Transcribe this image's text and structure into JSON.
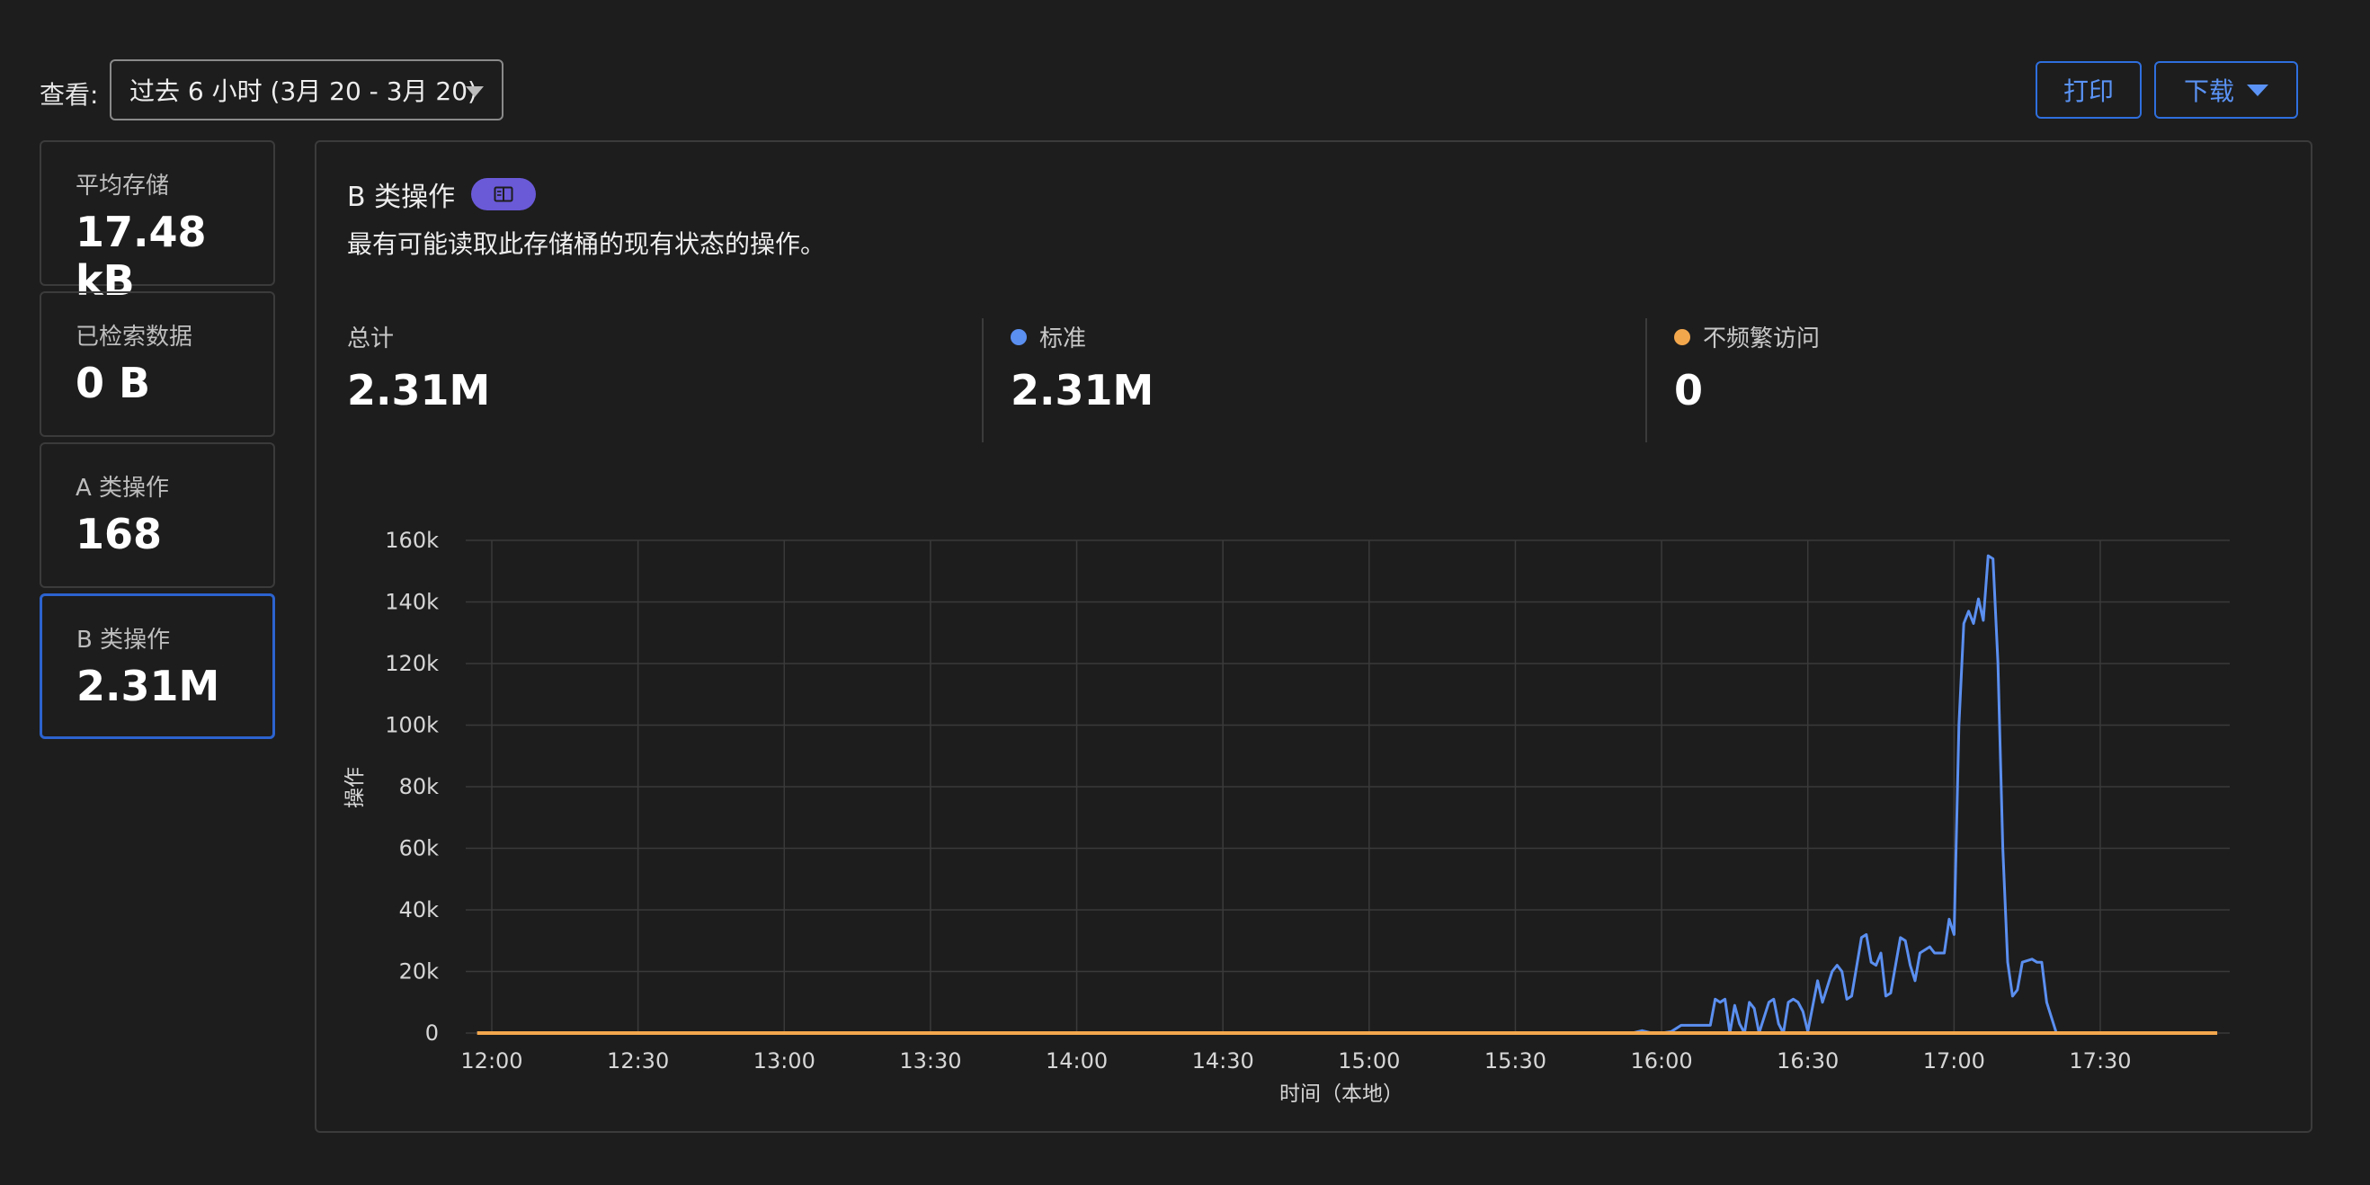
{
  "toolbar": {
    "view_label": "查看:",
    "range_value": "过去 6 小时 (3月 20 - 3月 20)",
    "print_label": "打印",
    "download_label": "下载"
  },
  "cards": [
    {
      "label": "平均存储",
      "value": "17.48 kB"
    },
    {
      "label": "已检索数据",
      "value": "0 B"
    },
    {
      "label": "A 类操作",
      "value": "168"
    },
    {
      "label": "B 类操作",
      "value": "2.31M"
    }
  ],
  "panel": {
    "title": "B 类操作",
    "badge_icon": "book-icon",
    "description": "最有可能读取此存储桶的现有状态的操作。",
    "stats": [
      {
        "label": "总计",
        "value": "2.31M"
      },
      {
        "label": "标准",
        "value": "2.31M",
        "color": "#5b8ff0"
      },
      {
        "label": "不频繁访问",
        "value": "0",
        "color": "#f3a74d"
      }
    ]
  },
  "chart_data": {
    "type": "line",
    "xlabel": "时间（本地）",
    "ylabel": "操作",
    "ylim": [
      0,
      160000
    ],
    "x_ticks": [
      "12:00",
      "12:30",
      "13:00",
      "13:30",
      "14:00",
      "14:30",
      "15:00",
      "15:30",
      "16:00",
      "16:30",
      "17:00",
      "17:30"
    ],
    "y_ticks": [
      "0",
      "20k",
      "40k",
      "60k",
      "80k",
      "100k",
      "120k",
      "140k",
      "160k"
    ],
    "grid": true,
    "series": [
      {
        "name": "标准",
        "color": "#5b8ff0",
        "points": [
          [
            "11:57",
            0
          ],
          [
            "15:54",
            0
          ],
          [
            "15:56",
            800
          ],
          [
            "15:58",
            0
          ],
          [
            "16:00",
            0
          ],
          [
            "16:02",
            500
          ],
          [
            "16:04",
            2500
          ],
          [
            "16:06",
            2500
          ],
          [
            "16:08",
            2500
          ],
          [
            "16:10",
            2500
          ],
          [
            "16:11",
            11000
          ],
          [
            "16:12",
            10000
          ],
          [
            "16:13",
            11000
          ],
          [
            "16:14",
            0
          ],
          [
            "16:15",
            9000
          ],
          [
            "16:16",
            3000
          ],
          [
            "16:17",
            0
          ],
          [
            "16:18",
            10000
          ],
          [
            "16:19",
            8000
          ],
          [
            "16:20",
            0
          ],
          [
            "16:22",
            10000
          ],
          [
            "16:23",
            11000
          ],
          [
            "16:24",
            3000
          ],
          [
            "16:25",
            0
          ],
          [
            "16:26",
            10000
          ],
          [
            "16:27",
            11000
          ],
          [
            "16:28",
            10000
          ],
          [
            "16:29",
            7000
          ],
          [
            "16:30",
            500
          ],
          [
            "16:32",
            17000
          ],
          [
            "16:33",
            10000
          ],
          [
            "16:35",
            20000
          ],
          [
            "16:36",
            22000
          ],
          [
            "16:37",
            20000
          ],
          [
            "16:38",
            11000
          ],
          [
            "16:39",
            12000
          ],
          [
            "16:41",
            31000
          ],
          [
            "16:42",
            32000
          ],
          [
            "16:43",
            23000
          ],
          [
            "16:44",
            22000
          ],
          [
            "16:45",
            26000
          ],
          [
            "16:46",
            12000
          ],
          [
            "16:47",
            13000
          ],
          [
            "16:49",
            31000
          ],
          [
            "16:50",
            30000
          ],
          [
            "16:51",
            22000
          ],
          [
            "16:52",
            17000
          ],
          [
            "16:53",
            26000
          ],
          [
            "16:55",
            28000
          ],
          [
            "16:56",
            26000
          ],
          [
            "16:57",
            26000
          ],
          [
            "16:58",
            26000
          ],
          [
            "16:59",
            37000
          ],
          [
            "17:00",
            32000
          ],
          [
            "17:01",
            100000
          ],
          [
            "17:02",
            133000
          ],
          [
            "17:03",
            137000
          ],
          [
            "17:04",
            133000
          ],
          [
            "17:05",
            141000
          ],
          [
            "17:06",
            134000
          ],
          [
            "17:07",
            155000
          ],
          [
            "17:08",
            154000
          ],
          [
            "17:09",
            120000
          ],
          [
            "17:10",
            60000
          ],
          [
            "17:11",
            23000
          ],
          [
            "17:12",
            12000
          ],
          [
            "17:13",
            14000
          ],
          [
            "17:14",
            23000
          ],
          [
            "17:16",
            24000
          ],
          [
            "17:17",
            23000
          ],
          [
            "17:18",
            23000
          ],
          [
            "17:19",
            10000
          ],
          [
            "17:21",
            0
          ]
        ]
      },
      {
        "name": "不频繁访问",
        "color": "#f3a74d",
        "points": [
          [
            "11:57",
            0
          ],
          [
            "17:54",
            0
          ]
        ]
      }
    ]
  }
}
